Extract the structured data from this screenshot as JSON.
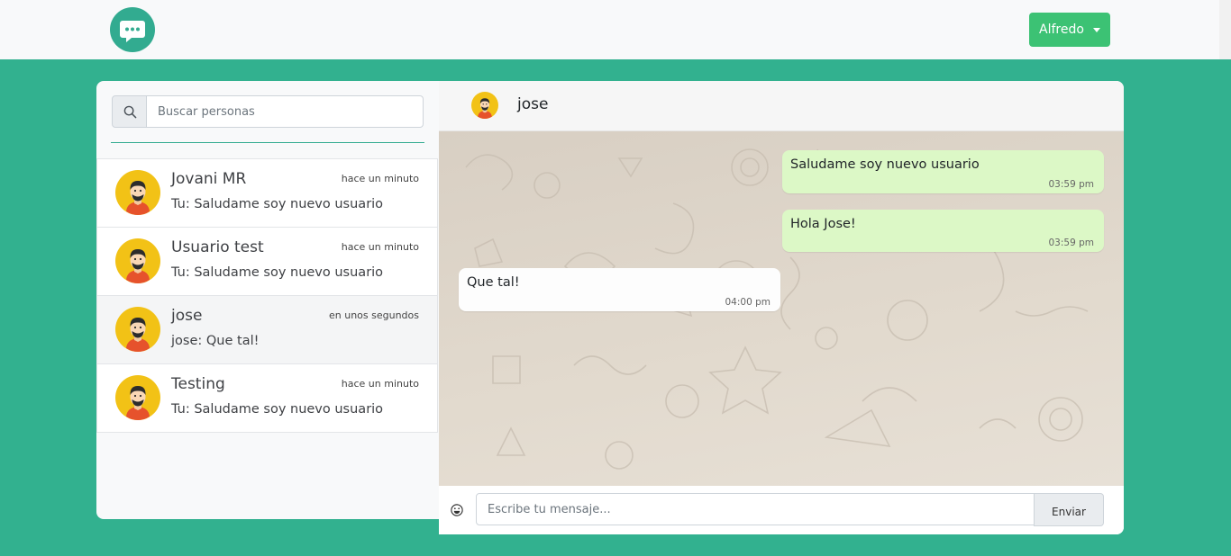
{
  "header": {
    "logo_icon": "chat-bubble-icon",
    "user_menu_label": "Alfredo"
  },
  "sidebar": {
    "search_placeholder": "Buscar personas",
    "chats": [
      {
        "name": "Jovani MR",
        "time": "hace un minuto",
        "preview": "Tu: Saludame soy nuevo usuario",
        "active": false
      },
      {
        "name": "Usuario test",
        "time": "hace un minuto",
        "preview": "Tu: Saludame soy nuevo usuario",
        "active": false
      },
      {
        "name": "jose",
        "time": "en unos segundos",
        "preview": "jose: Que tal!",
        "active": true
      },
      {
        "name": "Testing",
        "time": "hace un minuto",
        "preview": "Tu: Saludame soy nuevo usuario",
        "active": false
      }
    ]
  },
  "conversation": {
    "contact_name": "jose",
    "messages": [
      {
        "text": "Saludame soy nuevo usuario",
        "time": "03:59 pm",
        "direction": "out"
      },
      {
        "text": "Hola Jose!",
        "time": "03:59 pm",
        "direction": "out"
      },
      {
        "text": "Que tal!",
        "time": "04:00 pm",
        "direction": "in"
      }
    ]
  },
  "composer": {
    "placeholder": "Escribe tu mensaje...",
    "send_label": "Enviar",
    "emoji_icon": "emoji-icon"
  },
  "colors": {
    "page_bg": "#32b18f",
    "accent_button": "#3cc274",
    "outgoing_bubble": "#dcf8c6"
  }
}
